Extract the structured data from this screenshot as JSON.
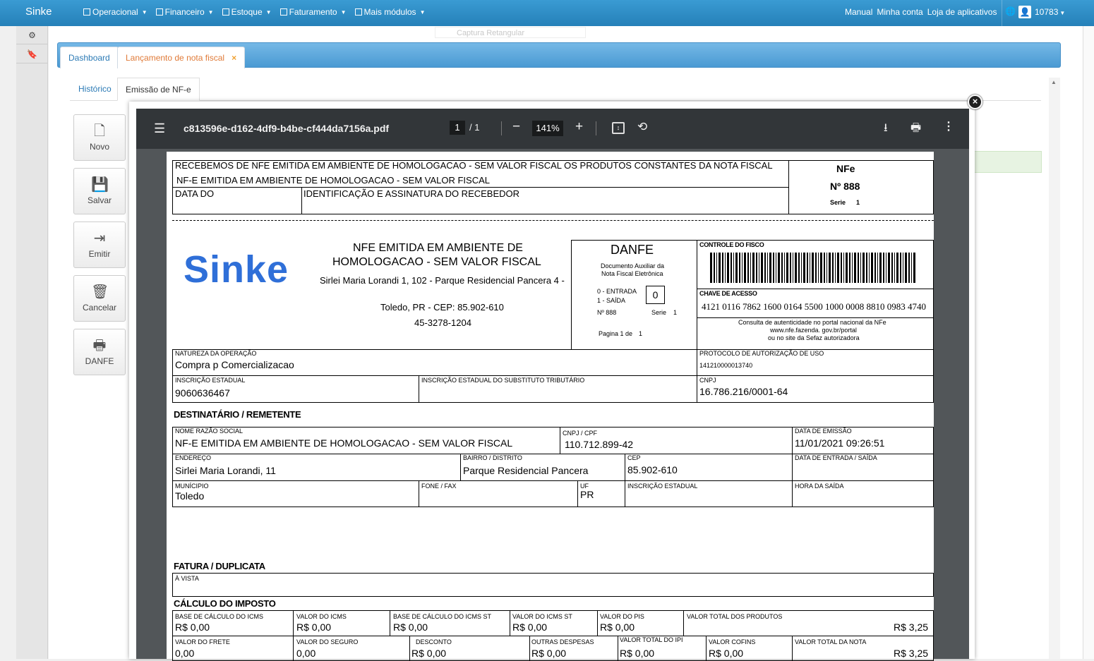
{
  "app": {
    "brand": "Sinke",
    "menu": [
      "Operacional",
      "Financeiro",
      "Estoque",
      "Faturamento",
      "Mais módulos"
    ],
    "links": [
      "Manual",
      "Minha conta",
      "Loja de aplicativos"
    ],
    "user_id": "10783"
  },
  "overlay": {
    "ghost_label": "Captura Retangular"
  },
  "tabs": [
    "Dashboard",
    "Lançamento de nota fiscal"
  ],
  "subtabs": [
    "Histórico",
    "Emissão de NF-e"
  ],
  "actions": [
    "Novo",
    "Salvar",
    "Emitir",
    "Cancelar",
    "DANFE"
  ],
  "pdf": {
    "filename": "c813596e-d162-4df9-b4be-cf444da7156a.pdf",
    "page_current": "1",
    "page_total": "/ 1",
    "zoom": "141%"
  },
  "danfe": {
    "receipt_line1": "RECEBEMOS DE NFE EMITIDA EM AMBIENTE DE HOMOLOGACAO - SEM VALOR FISCAL OS PRODUTOS CONSTANTES DA NOTA FISCAL",
    "receipt_line2": "NF-E EMITIDA EM AMBIENTE DE HOMOLOGACAO - SEM VALOR FISCAL",
    "data_do": "DATA DO",
    "ident_assinatura": "IDENTIFICAÇÃO E ASSINATURA DO RECEBEDOR",
    "nfe_label": "NFe",
    "nfe_num": "Nº 888",
    "serie_small": "Serie",
    "serie_val": "1",
    "logo": "Sinke",
    "emit_name_l1": "NFE EMITIDA EM AMBIENTE DE",
    "emit_name_l2": "HOMOLOGACAO - SEM VALOR FISCAL",
    "emit_addr": "Sirlei Maria Lorandi 1, 102 - Parque Residencial Pancera 4 -",
    "emit_city": "Toledo, PR - CEP: 85.902-610",
    "emit_phone": "45-3278-1204",
    "danfe_title": "DANFE",
    "danfe_sub1": "Documento Auxiliar da",
    "danfe_sub2": "Nota Fiscal Eletrônica",
    "entrada": "0 - ENTRADA",
    "saida": "1 - SAÍDA",
    "tipo_val": "0",
    "n_small": "Nº 888",
    "serie_small2": "Serie",
    "serie_val2": "1",
    "pagina": "Pagina 1 de",
    "pagina_val": "1",
    "controle_fisco": "CONTROLE DO FISCO",
    "chave_label": "CHAVE DE ACESSO",
    "chave_val": "4121 0116 7862 1600 0164 5500 1000 0008 8810 0983 4740",
    "consulta_l1": "Consulta de autenticidade no portal nacional da NFe",
    "consulta_l2": "www.nfe.fazenda. gov.br/portal",
    "consulta_l3": "ou no site da Sefaz autorizadora",
    "natureza_lbl": "NATUREZA DA OPERAÇÃO",
    "natureza_val": "Compra p Comercializacao",
    "protocolo_lbl": "PROTOCOLO DE AUTORIZAÇÃO DE USO",
    "protocolo_val": "141210000013740",
    "ie_lbl": "INSCRIÇÃO ESTADUAL",
    "ie_val": "9060636467",
    "iest_lbl": "INSCRIÇÃO ESTADUAL DO SUBSTITUTO TRIBUTÁRIO",
    "cnpj_lbl": "CNPJ",
    "cnpj_val": "16.786.216/0001-64",
    "dest_title": "DESTINATÁRIO / REMETENTE",
    "nome_lbl": "NOME RAZÃO SOCIAL",
    "nome_val": "NF-E EMITIDA EM AMBIENTE DE HOMOLOGACAO - SEM VALOR FISCAL",
    "cpf_lbl": "CNPJ / CPF",
    "cpf_val": "110.712.899-42",
    "emissao_lbl": "DATA DE EMISSÃO",
    "emissao_val": "11/01/2021 09:26:51",
    "end_lbl": "ENDEREÇO",
    "end_val": "Sirlei Maria Lorandi, 11",
    "bairro_lbl": "BAIRRO / DISTRITO",
    "bairro_val": "Parque Residencial Pancera",
    "cep_lbl": "CEP",
    "cep_val": "85.902-610",
    "entsai_lbl": "DATA DE ENTRADA / SAÍDA",
    "mun_lbl": "MUNÍCIPIO",
    "mun_val": "Toledo",
    "fone_lbl": "FONE / FAX",
    "uf_lbl": "UF",
    "uf_val": "PR",
    "ie2_lbl": "INSCRIÇÃO ESTADUAL",
    "hora_lbl": "HORA DA SAÍDA",
    "fatura_title": "FATURA / DUPLICATA",
    "avista": "À VISTA",
    "calc_title": "CÁLCULO DO IMPOSTO",
    "calc_row1": [
      {
        "lbl": "BASE DE CÁLCULO DO ICMS",
        "val": "R$ 0,00"
      },
      {
        "lbl": "VALOR DO ICMS",
        "val": "R$ 0,00"
      },
      {
        "lbl": "BASE DE CÁLCULO DO ICMS ST",
        "val": "R$ 0,00"
      },
      {
        "lbl": "VALOR DO ICMS ST",
        "val": "R$ 0,00"
      },
      {
        "lbl": "VALOR DO PIS",
        "val": "R$ 0,00"
      },
      {
        "lbl": "VALOR TOTAL DOS PRODUTOS",
        "val": "R$ 3,25"
      }
    ],
    "calc_row2": [
      {
        "lbl": "VALOR DO FRETE",
        "val": "0,00"
      },
      {
        "lbl": "VALOR DO SEGURO",
        "val": "0,00"
      },
      {
        "lbl": "DESCONTO",
        "val": "R$ 0,00"
      },
      {
        "lbl": "OUTRAS DESPESAS",
        "val": "R$ 0,00"
      },
      {
        "lbl": "VALOR TOTAL DO IPI",
        "val": "R$ 0,00"
      },
      {
        "lbl": "VALOR COFINS",
        "val": "R$ 0,00"
      },
      {
        "lbl": "VALOR TOTAL DA NOTA",
        "val": "R$ 3,25"
      }
    ]
  }
}
